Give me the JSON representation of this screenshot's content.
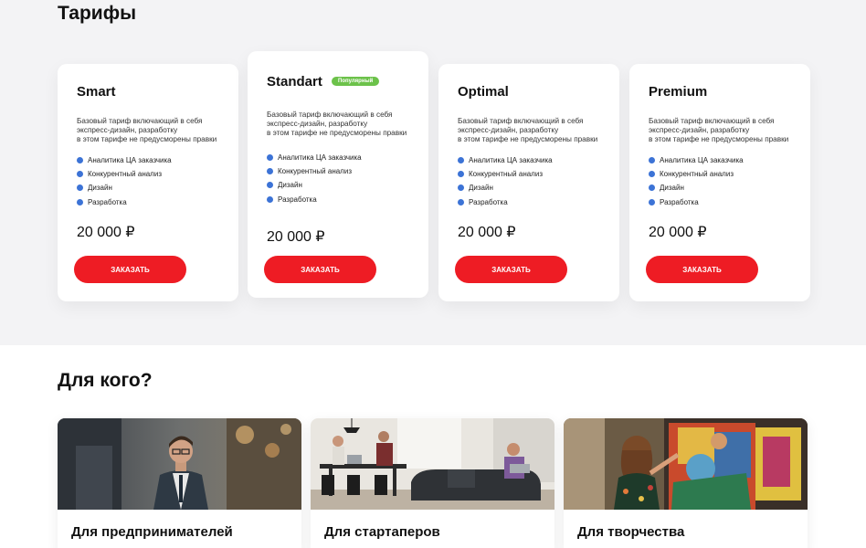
{
  "tariffs": {
    "title": "Тарифы",
    "cards": [
      {
        "name": "Smart",
        "badge": "",
        "description": [
          "Базовый тариф включающий в себя",
          "экспресс-дизайн, разработку",
          "в этом тарифе не предусморены правки"
        ],
        "features": [
          "Аналитика ЦА заказчика",
          "Конкурентный анализ",
          "Дизайн",
          "Разработка"
        ],
        "price": "20 000 ₽",
        "button": "ЗАКАЗАТЬ"
      },
      {
        "name": "Standart",
        "badge": "Популярный",
        "description": [
          "Базовый тариф включающий в себя",
          "экспресс-дизайн, разработку",
          "в этом тарифе не предусморены правки"
        ],
        "features": [
          "Аналитика ЦА заказчика",
          "Конкурентный анализ",
          "Дизайн",
          "Разработка"
        ],
        "price": "20 000 ₽",
        "button": "ЗАКАЗАТЬ"
      },
      {
        "name": "Optimal",
        "badge": "",
        "description": [
          "Базовый тариф включающий в себя",
          "экспресс-дизайн, разработку",
          "в этом тарифе не предусморены правки"
        ],
        "features": [
          "Аналитика ЦА заказчика",
          "Конкурентный анализ",
          "Дизайн",
          "Разработка"
        ],
        "price": "20 000 ₽",
        "button": "ЗАКАЗАТЬ"
      },
      {
        "name": "Premium",
        "badge": "",
        "description": [
          "Базовый тариф включающий в себя",
          "экспресс-дизайн, разработку",
          "в этом тарифе не предусморены правки"
        ],
        "features": [
          "Аналитика ЦА заказчика",
          "Конкурентный анализ",
          "Дизайн",
          "Разработка"
        ],
        "price": "20 000 ₽",
        "button": "ЗАКАЗАТЬ"
      }
    ]
  },
  "audience": {
    "title": "Для кого?",
    "items": [
      {
        "label": "Для предпринимателей"
      },
      {
        "label": "Для стартаперов"
      },
      {
        "label": "Для творчества"
      }
    ]
  },
  "colors": {
    "accent_red": "#ee1c24",
    "badge_green": "#6cc24a",
    "bullet_blue": "#3c73d6",
    "section_bg": "#f3f3f5"
  }
}
